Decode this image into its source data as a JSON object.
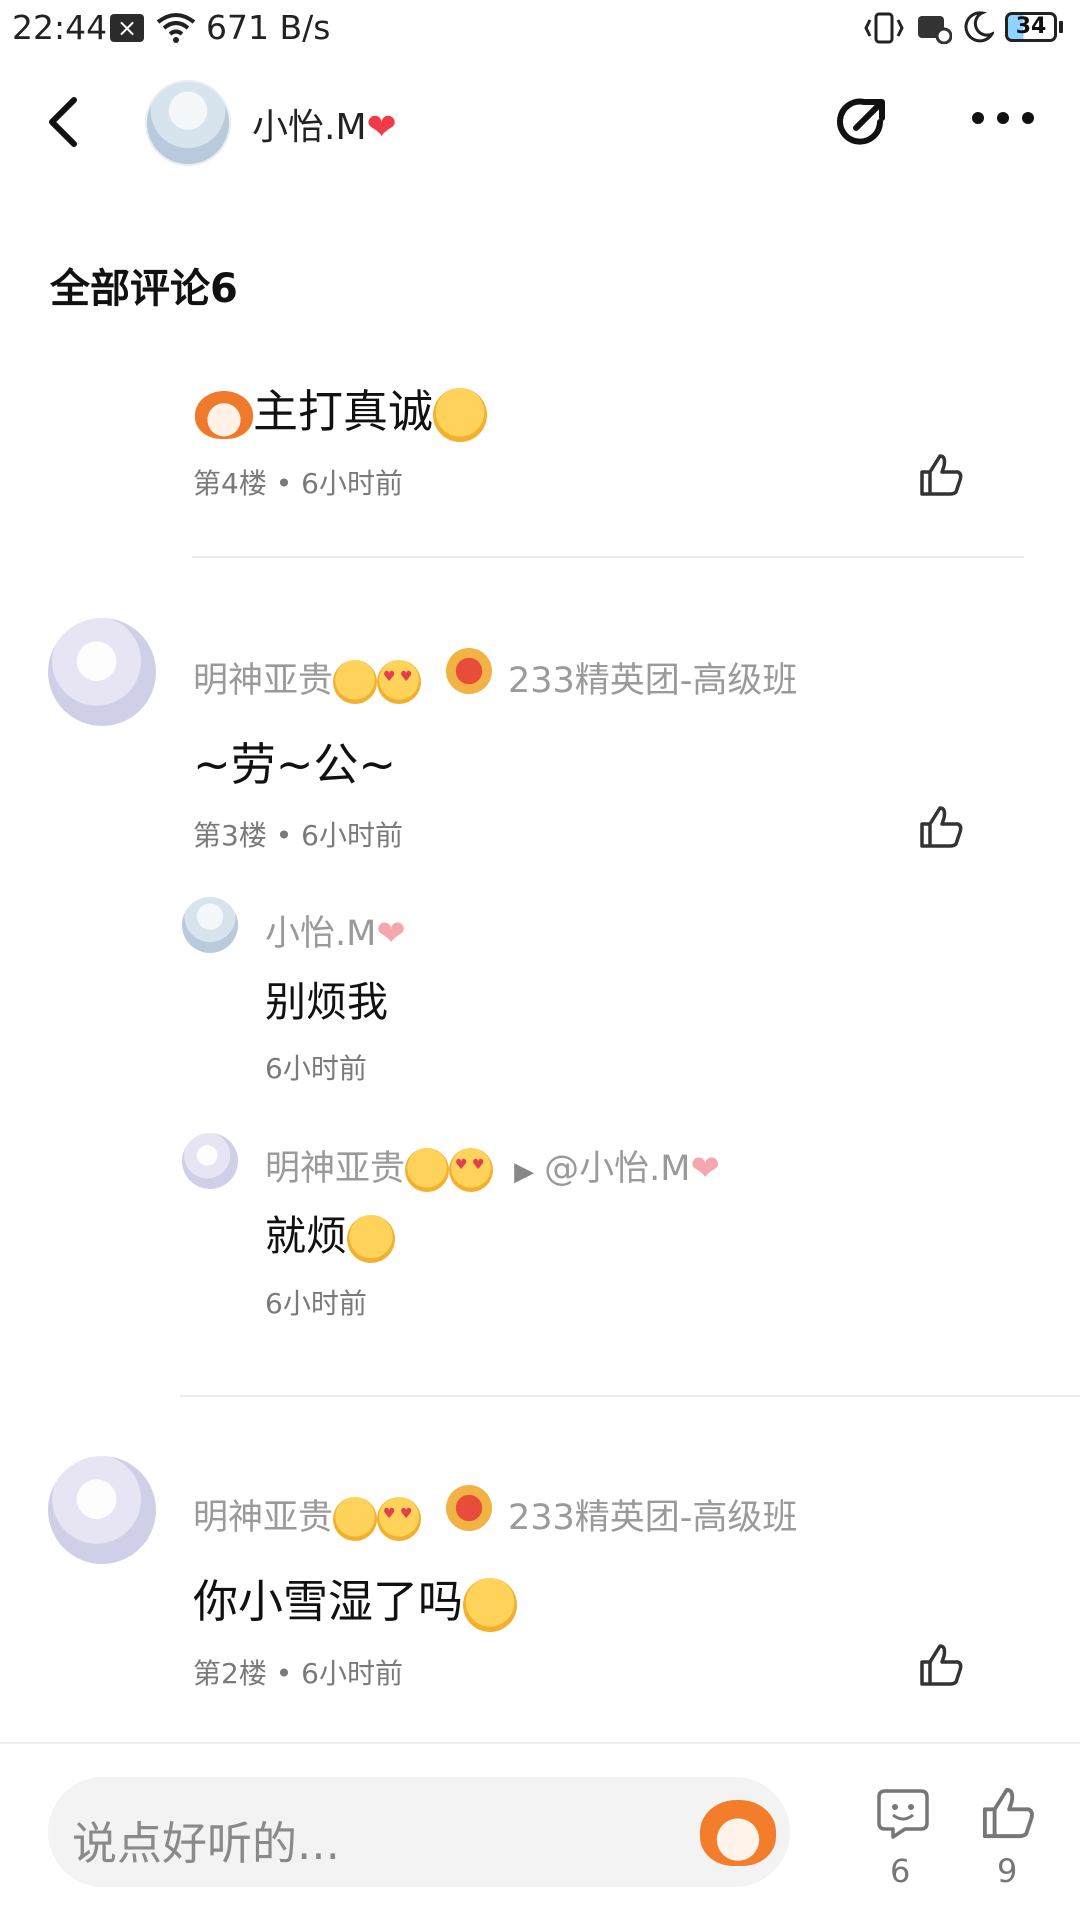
{
  "status_bar": {
    "time": "22:44",
    "net_speed": "671 B/s",
    "battery": "34"
  },
  "header": {
    "user_name": "小怡.M",
    "heart": "❤"
  },
  "section_title": "全部评论6",
  "comments": [
    {
      "content": "主打真诚",
      "meta": "第4楼 • 6小时前"
    },
    {
      "name": "明神亚贵",
      "badge": "233精英团-高级班",
      "content": "~劳~公~",
      "meta": "第3楼 • 6小时前",
      "replies": [
        {
          "name": "小怡.M",
          "heart": "❤",
          "content": "别烦我",
          "time": "6小时前"
        },
        {
          "name": "明神亚贵",
          "arrow": "▶",
          "target": "@小怡.M",
          "heart": "❤",
          "content": "就烦",
          "time": "6小时前"
        }
      ]
    },
    {
      "name": "明神亚贵",
      "badge": "233精英团-高级班",
      "content": "你小雪湿了吗",
      "meta": "第2楼 • 6小时前"
    }
  ],
  "bottom": {
    "placeholder": "说点好听的...",
    "comment_count": "6",
    "like_count": "9"
  }
}
